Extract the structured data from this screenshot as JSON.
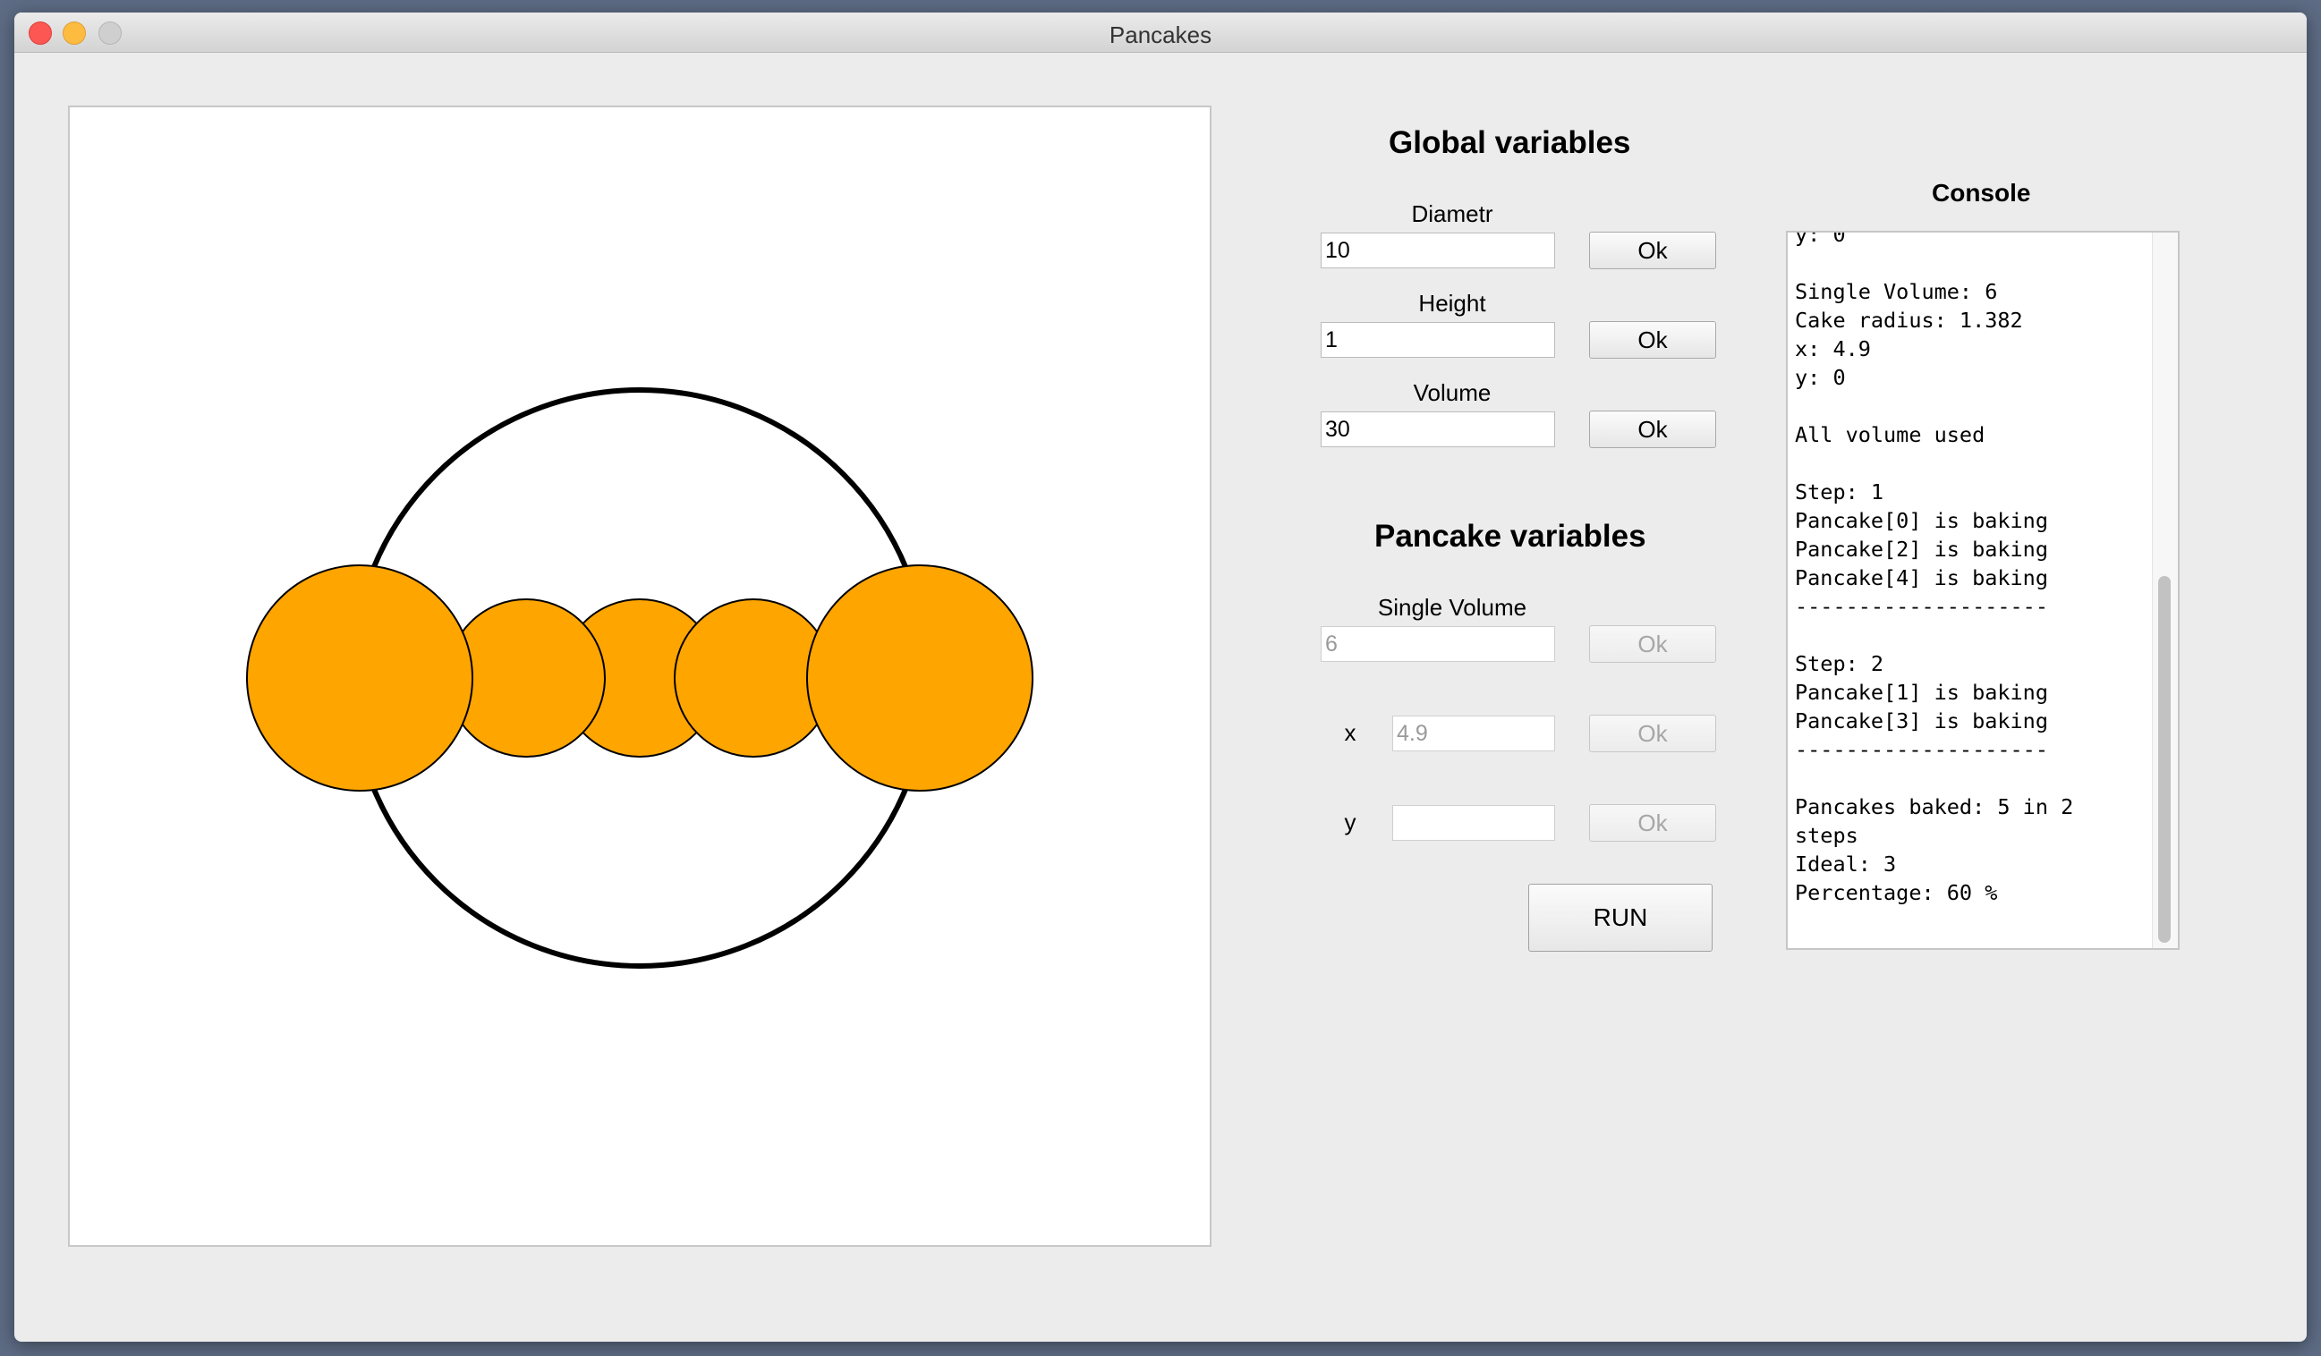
{
  "window": {
    "title": "Pancakes"
  },
  "global": {
    "heading": "Global variables",
    "diameter": {
      "label": "Diametr",
      "value": "10",
      "ok": "Ok"
    },
    "height": {
      "label": "Height",
      "value": "1",
      "ok": "Ok"
    },
    "volume": {
      "label": "Volume",
      "value": "30",
      "ok": "Ok"
    }
  },
  "pancake": {
    "heading": "Pancake variables",
    "single_volume": {
      "label": "Single Volume",
      "value": "6",
      "ok": "Ok"
    },
    "x": {
      "label": "x",
      "value": "4.9",
      "ok": "Ok"
    },
    "y": {
      "label": "y",
      "value": "",
      "ok": "Ok"
    },
    "run_label": "RUN"
  },
  "console": {
    "heading": "Console",
    "text": "y: 0\n\nSingle Volume: 6\nCake radius: 1.382\nx: 4.9\ny: 0\n\nAll volume used\n\nStep: 1\nPancake[0] is baking\nPancake[2] is baking\nPancake[4] is baking\n--------------------\n\nStep: 2\nPancake[1] is baking\nPancake[3] is baking\n--------------------\n\nPancakes baked: 5 in 2\nsteps\nIdeal: 3\nPercentage: 60 %"
  },
  "colors": {
    "pancake_fill": "#FFA500",
    "pan_stroke": "#000000"
  }
}
